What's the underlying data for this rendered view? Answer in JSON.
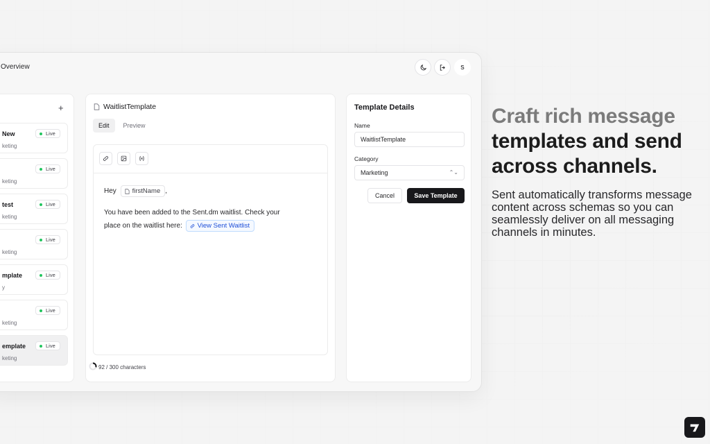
{
  "app": {
    "breadcrumb": "Overview",
    "avatar_initial": "s"
  },
  "sidebar": {
    "add_label": "+",
    "items": [
      {
        "name": "New",
        "category": "keting",
        "status": "Live"
      },
      {
        "name": "",
        "category": "keting",
        "status": "Live"
      },
      {
        "name": "test",
        "category": "keting",
        "status": "Live"
      },
      {
        "name": "",
        "category": "keting",
        "status": "Live"
      },
      {
        "name": "mplate",
        "category": "y",
        "status": "Live"
      },
      {
        "name": "",
        "category": "keting",
        "status": "Live"
      },
      {
        "name": "emplate",
        "category": "keting",
        "status": "Live",
        "active": true
      }
    ]
  },
  "editor": {
    "title": "WaitlistTemplate",
    "tabs": [
      {
        "label": "Edit",
        "active": true
      },
      {
        "label": "Preview",
        "active": false
      }
    ],
    "tools": [
      "link-icon",
      "image-icon",
      "variable-icon"
    ],
    "greeting_prefix": "Hey",
    "variable_chip": "firstName",
    "greeting_suffix": ",",
    "body_line1": "You have been added to the Sent.dm waitlist. Check your",
    "body_line2_prefix": "place on the waitlist here:",
    "link_chip": "View Sent Waitlist",
    "char_count": "92 / 300 characters"
  },
  "details": {
    "title": "Template Details",
    "name_label": "Name",
    "name_value": "WaitlistTemplate",
    "category_label": "Category",
    "category_value": "Marketing",
    "cancel_label": "Cancel",
    "save_label": "Save Template"
  },
  "marketing": {
    "headline_muted": "Craft rich message",
    "headline_dark": "templates and send across channels.",
    "subcopy": "Sent automatically transforms message content across schemas so you can seamlessly deliver on all messaging channels in minutes."
  },
  "colors": {
    "accent_dark": "#18181b",
    "live_dot": "#22c55e",
    "link_blue": "#1d4ed8"
  }
}
